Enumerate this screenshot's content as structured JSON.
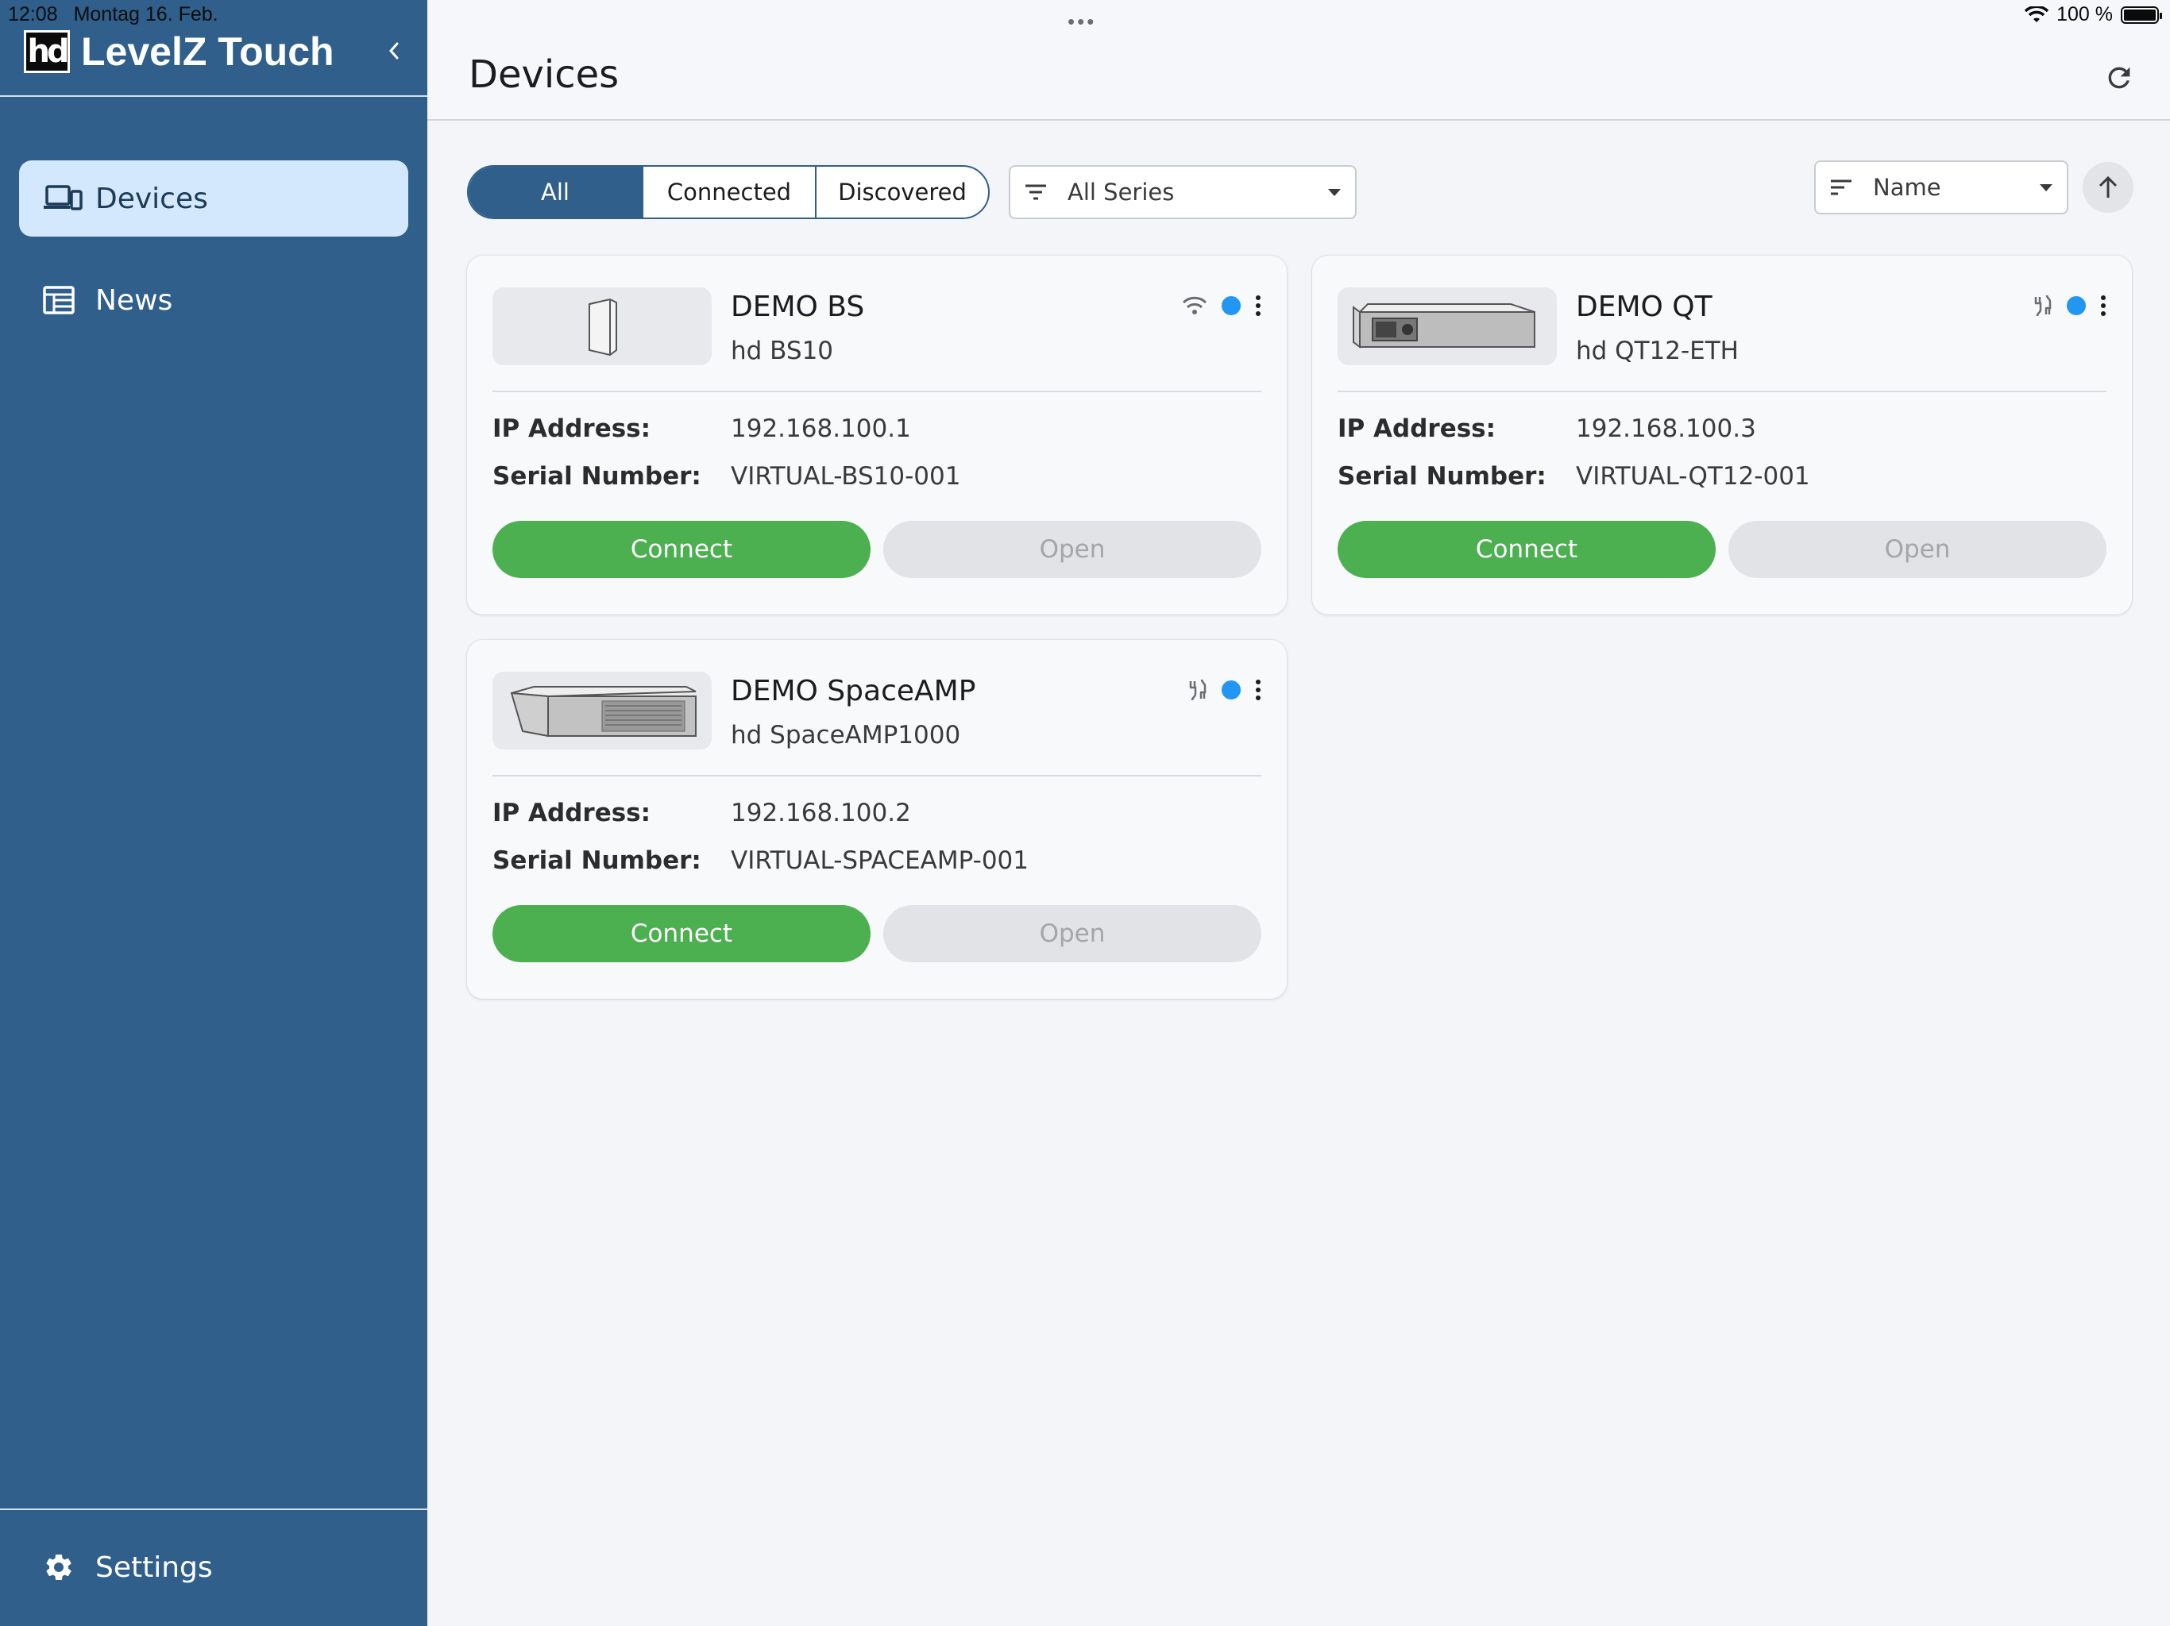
{
  "status_bar": {
    "time": "12:08",
    "date": "Montag 16. Feb.",
    "battery": "100 %",
    "battery_level": 1.0
  },
  "sidebar": {
    "brand": "LevelZ Touch",
    "logo_text": "hd",
    "items": [
      {
        "label": "Devices",
        "icon": "devices-icon",
        "active": true
      },
      {
        "label": "News",
        "icon": "news-icon",
        "active": false
      }
    ],
    "settings_label": "Settings"
  },
  "header": {
    "title": "Devices"
  },
  "filters": {
    "segments": [
      "All",
      "Connected",
      "Discovered"
    ],
    "selected_segment": "All",
    "series": "All Series",
    "sort": "Name"
  },
  "labels": {
    "ip": "IP Address:",
    "serial": "Serial Number:",
    "connect": "Connect",
    "open": "Open"
  },
  "devices": [
    {
      "name": "DEMO BS",
      "model": "hd BS10",
      "ip": "192.168.100.1",
      "serial": "VIRTUAL-BS10-001",
      "link_icon": "wifi-icon"
    },
    {
      "name": "DEMO QT",
      "model": "hd QT12-ETH",
      "ip": "192.168.100.3",
      "serial": "VIRTUAL-QT12-001",
      "link_icon": "ethernet-icon"
    },
    {
      "name": "DEMO SpaceAMP",
      "model": "hd SpaceAMP1000",
      "ip": "192.168.100.2",
      "serial": "VIRTUAL-SPACEAMP-001",
      "link_icon": "ethernet-icon"
    }
  ],
  "colors": {
    "sidebar": "#2f5f8a",
    "active_nav": "#d3e8fd",
    "connect": "#4caf50",
    "status_dot": "#2196f3"
  }
}
